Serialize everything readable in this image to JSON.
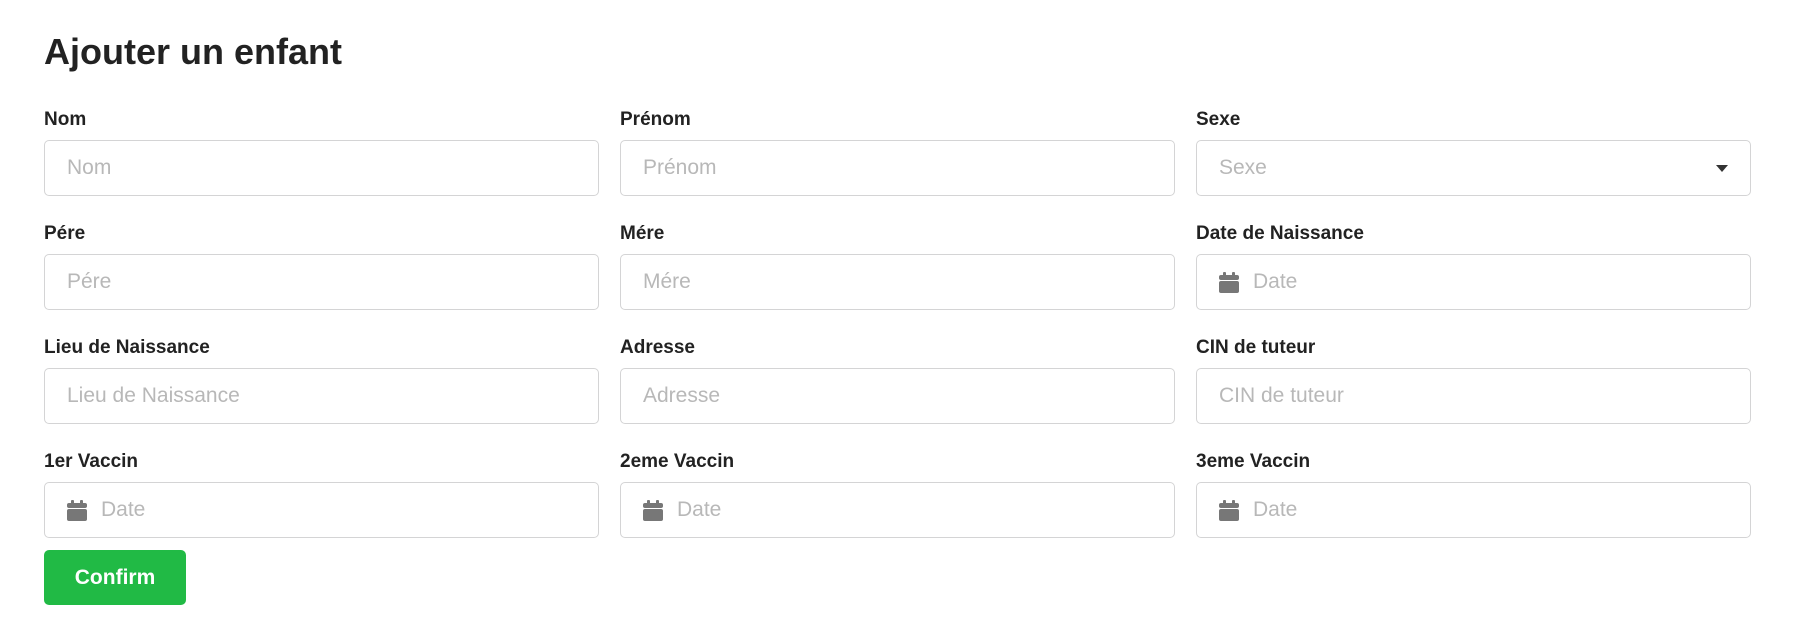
{
  "page": {
    "title": "Ajouter un enfant"
  },
  "form": {
    "nom": {
      "label": "Nom",
      "placeholder": "Nom"
    },
    "prenom": {
      "label": "Prénom",
      "placeholder": "Prénom"
    },
    "sexe": {
      "label": "Sexe",
      "placeholder": "Sexe"
    },
    "pere": {
      "label": "Pére",
      "placeholder": "Pére"
    },
    "mere": {
      "label": "Mére",
      "placeholder": "Mére"
    },
    "date_naissance": {
      "label": "Date de Naissance",
      "placeholder": "Date"
    },
    "lieu_naissance": {
      "label": "Lieu de Naissance",
      "placeholder": "Lieu de Naissance"
    },
    "adresse": {
      "label": "Adresse",
      "placeholder": "Adresse"
    },
    "cin_tuteur": {
      "label": "CIN de tuteur",
      "placeholder": "CIN de tuteur"
    },
    "vaccin1": {
      "label": "1er Vaccin",
      "placeholder": "Date"
    },
    "vaccin2": {
      "label": "2eme Vaccin",
      "placeholder": "Date"
    },
    "vaccin3": {
      "label": "3eme Vaccin",
      "placeholder": "Date"
    },
    "confirm_label": "Confirm"
  },
  "icons": {
    "date_field": "calendar-icon",
    "select_field": "caret-down-icon"
  },
  "colors": {
    "confirm_button": "#21ba45",
    "input_border": "#d4d4d5",
    "placeholder_text": "#b8b8b8"
  }
}
